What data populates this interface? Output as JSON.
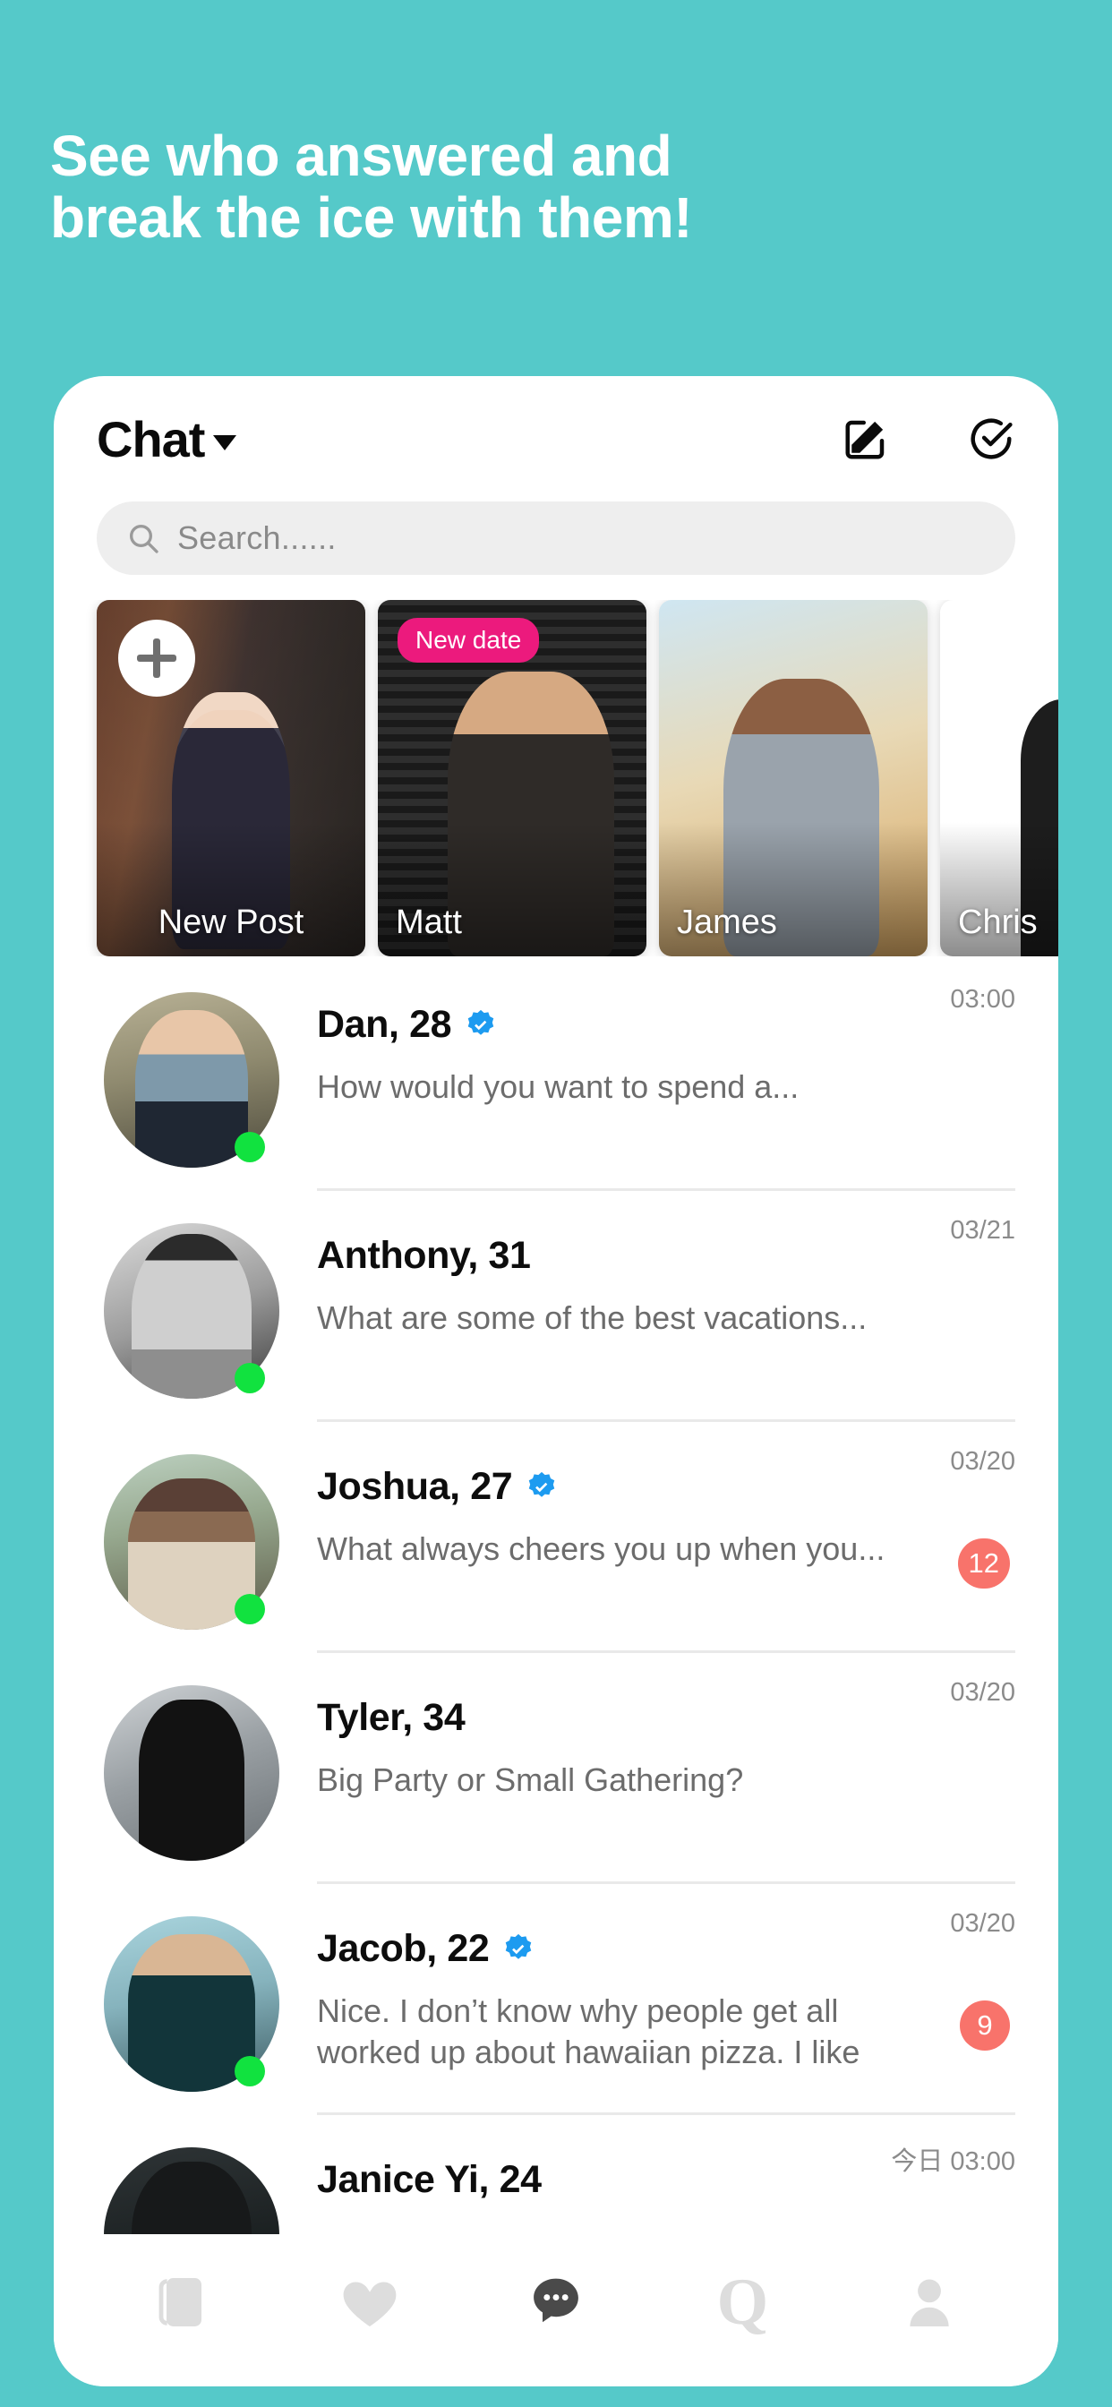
{
  "promo": {
    "line1": "See who answered and",
    "line2": "break the ice with them!",
    "background_color": "#55c9c9",
    "text_color": "#ffffff"
  },
  "app": {
    "header": {
      "title": "Chat",
      "dropdown_icon": "chevron-down-icon",
      "compose_icon": "compose-icon",
      "select_all_icon": "check-circle-icon"
    },
    "search": {
      "placeholder": "Search......",
      "icon": "search-icon"
    },
    "stories": [
      {
        "name": "New Post",
        "badge": "",
        "has_plus": true,
        "photo": "woman-striped-dress-railing"
      },
      {
        "name": "Matt",
        "badge": "New date",
        "has_plus": false,
        "photo": "man-denim-sherpa-jacket"
      },
      {
        "name": "James",
        "badge": "",
        "has_plus": false,
        "photo": "man-grey-denim-jacket"
      },
      {
        "name": "Chris",
        "badge": "",
        "has_plus": false,
        "photo": "man-black-tee-tattoo"
      }
    ],
    "badge_color": "#ec1a7d",
    "unread_color": "#f8736b",
    "online_color": "#11e23f",
    "verified_color": "#1d9bf0",
    "chats": [
      {
        "name": "Dan, 28",
        "verified": true,
        "online": true,
        "preview": "How would you want to spend a...",
        "time": "03:00",
        "unread": ""
      },
      {
        "name": "Anthony, 31",
        "verified": false,
        "online": true,
        "preview": "What are some of the best vacations...",
        "time": "03/21",
        "unread": ""
      },
      {
        "name": "Joshua, 27",
        "verified": true,
        "online": true,
        "preview": "What always cheers you up when you...",
        "time": "03/20",
        "unread": "12"
      },
      {
        "name": "Tyler, 34",
        "verified": false,
        "online": false,
        "preview": "Big Party or Small Gathering?",
        "time": "03/20",
        "unread": ""
      },
      {
        "name": "Jacob, 22",
        "verified": true,
        "online": true,
        "preview": "Nice. I don’t know why people get all worked up about hawaiian pizza. I like",
        "time": "03/20",
        "unread": "9"
      },
      {
        "name": "Janice Yi, 24",
        "verified": false,
        "online": false,
        "preview": "",
        "time": "今日 03:00",
        "unread": ""
      }
    ],
    "bottom_nav": [
      {
        "icon": "cards-deck-icon",
        "active": false
      },
      {
        "icon": "heart-icon",
        "active": false
      },
      {
        "icon": "chat-bubble-icon",
        "active": true
      },
      {
        "icon": "q-letter-icon",
        "active": false
      },
      {
        "icon": "person-icon",
        "active": false
      }
    ]
  }
}
